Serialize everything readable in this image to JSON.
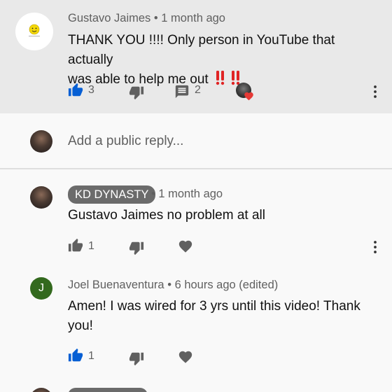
{
  "top_comment": {
    "author": "Gustavo Jaimes",
    "time": "• 1 month ago",
    "line1": "THANK YOU !!!! Only person in YouTube that actually",
    "line2": "was able to help me out",
    "emoji": "‼️‼️",
    "likes": "3",
    "replies": "2",
    "liked": true,
    "avatar_icon": "smiley-face-icon"
  },
  "reply_box": {
    "placeholder": "Add a public reply..."
  },
  "replies": [
    {
      "author": "KD DYNASTY",
      "time": "• 1 month ago",
      "text": "Gustavo Jaimes no problem at all",
      "likes": "1",
      "liked": false
    },
    {
      "author": "Joel Buenaventura",
      "time": "• 6 hours ago (edited)",
      "text_line1": "Amen! I was wired for 3 yrs until this video! Thank",
      "text_line2": "you!",
      "likes": "1",
      "liked": true,
      "avatar_letter": "J"
    }
  ],
  "colors": {
    "like_active": "#065fd4",
    "icon_gray": "#606060",
    "heart_red": "#e53935",
    "avatar_green": "#33691e",
    "pill_gray": "#6b6b6b"
  }
}
